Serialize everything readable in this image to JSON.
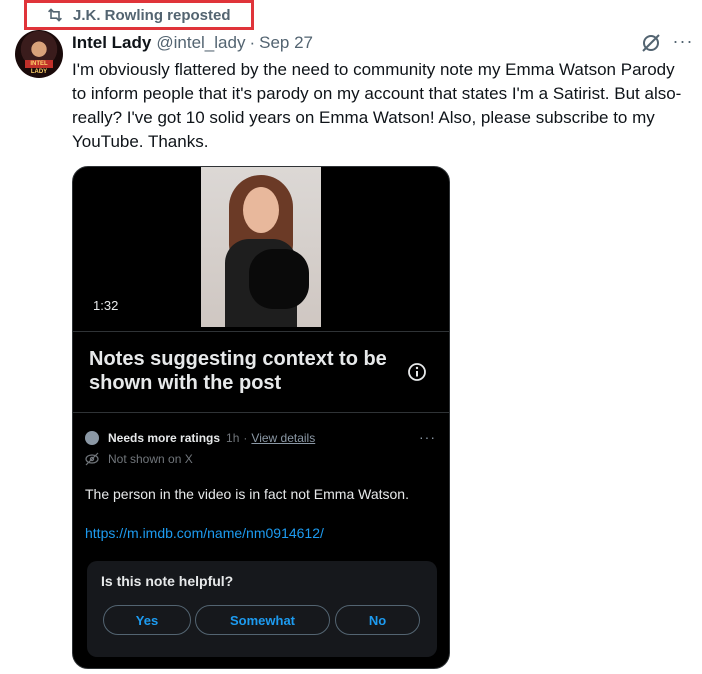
{
  "repost": {
    "label": "J.K. Rowling reposted",
    "icon": "repost-icon",
    "highlight_color": "#e0343a"
  },
  "tweet": {
    "author_name": "Intel Lady",
    "handle": "@intel_lady",
    "separator": "·",
    "date": "Sep 27",
    "text": "I'm obviously flattered by the need to community note my Emma Watson Parody to inform people that it's parody on my account that states I'm a Satirist. But also- really? I've got 10 solid years on Emma Watson!   Also, please subscribe to my YouTube. Thanks."
  },
  "actions": {
    "more": "···"
  },
  "card": {
    "video_duration": "1:32",
    "notes_title": "Notes suggesting context to be shown with the post",
    "note": {
      "status": "Needs more ratings",
      "time": "1h",
      "separator": "·",
      "view_details": "View details",
      "visibility": "Not shown on X",
      "more": "···",
      "text": "The person in the video is in fact not Emma Watson.",
      "link": "https://m.imdb.com/name/nm0914612/"
    },
    "helpful": {
      "question": "Is this note helpful?",
      "options": {
        "yes": "Yes",
        "somewhat": "Somewhat",
        "no": "No"
      }
    }
  },
  "colors": {
    "accent": "#1d9bf0",
    "muted": "#536471",
    "card_bg": "#000000"
  }
}
